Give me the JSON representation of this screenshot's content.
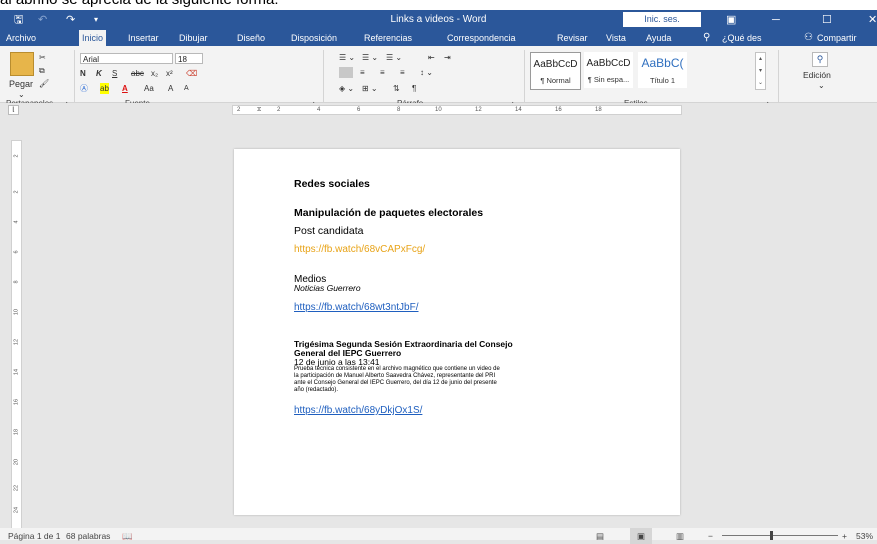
{
  "caption": "al abrirlo se aprecia de la siguiente forma:",
  "window": {
    "title": "Links a videos  -  Word",
    "signin": "Inic. ses."
  },
  "tabs": [
    "Archivo",
    "Inicio",
    "Insertar",
    "Dibujar",
    "Diseño",
    "Disposición",
    "Referencias",
    "Correspondencia",
    "Revisar",
    "Vista",
    "Ayuda",
    "¿Qué des",
    "Compartir"
  ],
  "ribbon": {
    "paste": "Pegar",
    "font_name": "Arial",
    "font_size": "18",
    "bold": "N",
    "italic": "K",
    "underline": "S",
    "strike": "abc",
    "sub": "x₂",
    "sup": "x²",
    "case": "Aa",
    "grow": "A",
    "shrink": "A",
    "pilcrow": "¶",
    "styles": [
      {
        "sample": "AaBbCcD",
        "name": "¶ Normal"
      },
      {
        "sample": "AaBbCcD",
        "name": "¶ Sin espa..."
      },
      {
        "sample": "AaBbC(",
        "name": "Título 1"
      }
    ],
    "editing": "Edición",
    "groups": {
      "clipboard": "Portapapeles",
      "font": "Fuente",
      "paragraph": "Párrafo",
      "styles": "Estilos"
    }
  },
  "ruler": {
    "h_ticks": [
      "2",
      "2",
      "4",
      "6",
      "8",
      "10",
      "12",
      "14",
      "16",
      "18"
    ],
    "v_ticks": [
      "2",
      "2",
      "4",
      "6",
      "8",
      "10",
      "12",
      "14",
      "16",
      "18",
      "20",
      "22",
      "24"
    ]
  },
  "document": {
    "heading_social": "Redes sociales",
    "heading_manip": "Manipulación de paquetes electorales",
    "post_label": "Post candidata",
    "link1": "https://fb.watch/68vCAPxFcg/",
    "media_label": "Medios",
    "media_source": "Noticias Guerrero",
    "link2": "https://fb.watch/68wt3ntJbF/",
    "session_title_1": "Trigésima Segunda Sesión Extraordinaria del Consejo",
    "session_title_2": "General del IEPC Guerrero",
    "session_date": "12 de junio a las 13:41",
    "desc_1": "Prueba técnica consistente en el archivo magnético que contiene un video de",
    "desc_2": "la participación de Manuel Alberto Saavedra Chávez, representante del PRI",
    "desc_3": "ante el Consejo General del IEPC Guerrero, del día 12 de junio del presente",
    "desc_4": "año (redactado).",
    "link3": "https://fb.watch/68yDkjOx1S/"
  },
  "status": {
    "page": "Página 1 de 1",
    "words": "68 palabras",
    "zoom": "53%"
  },
  "colors": {
    "brand": "#2b579a",
    "orange_link": "#e8a317",
    "blue_link": "#1f5fbf"
  }
}
